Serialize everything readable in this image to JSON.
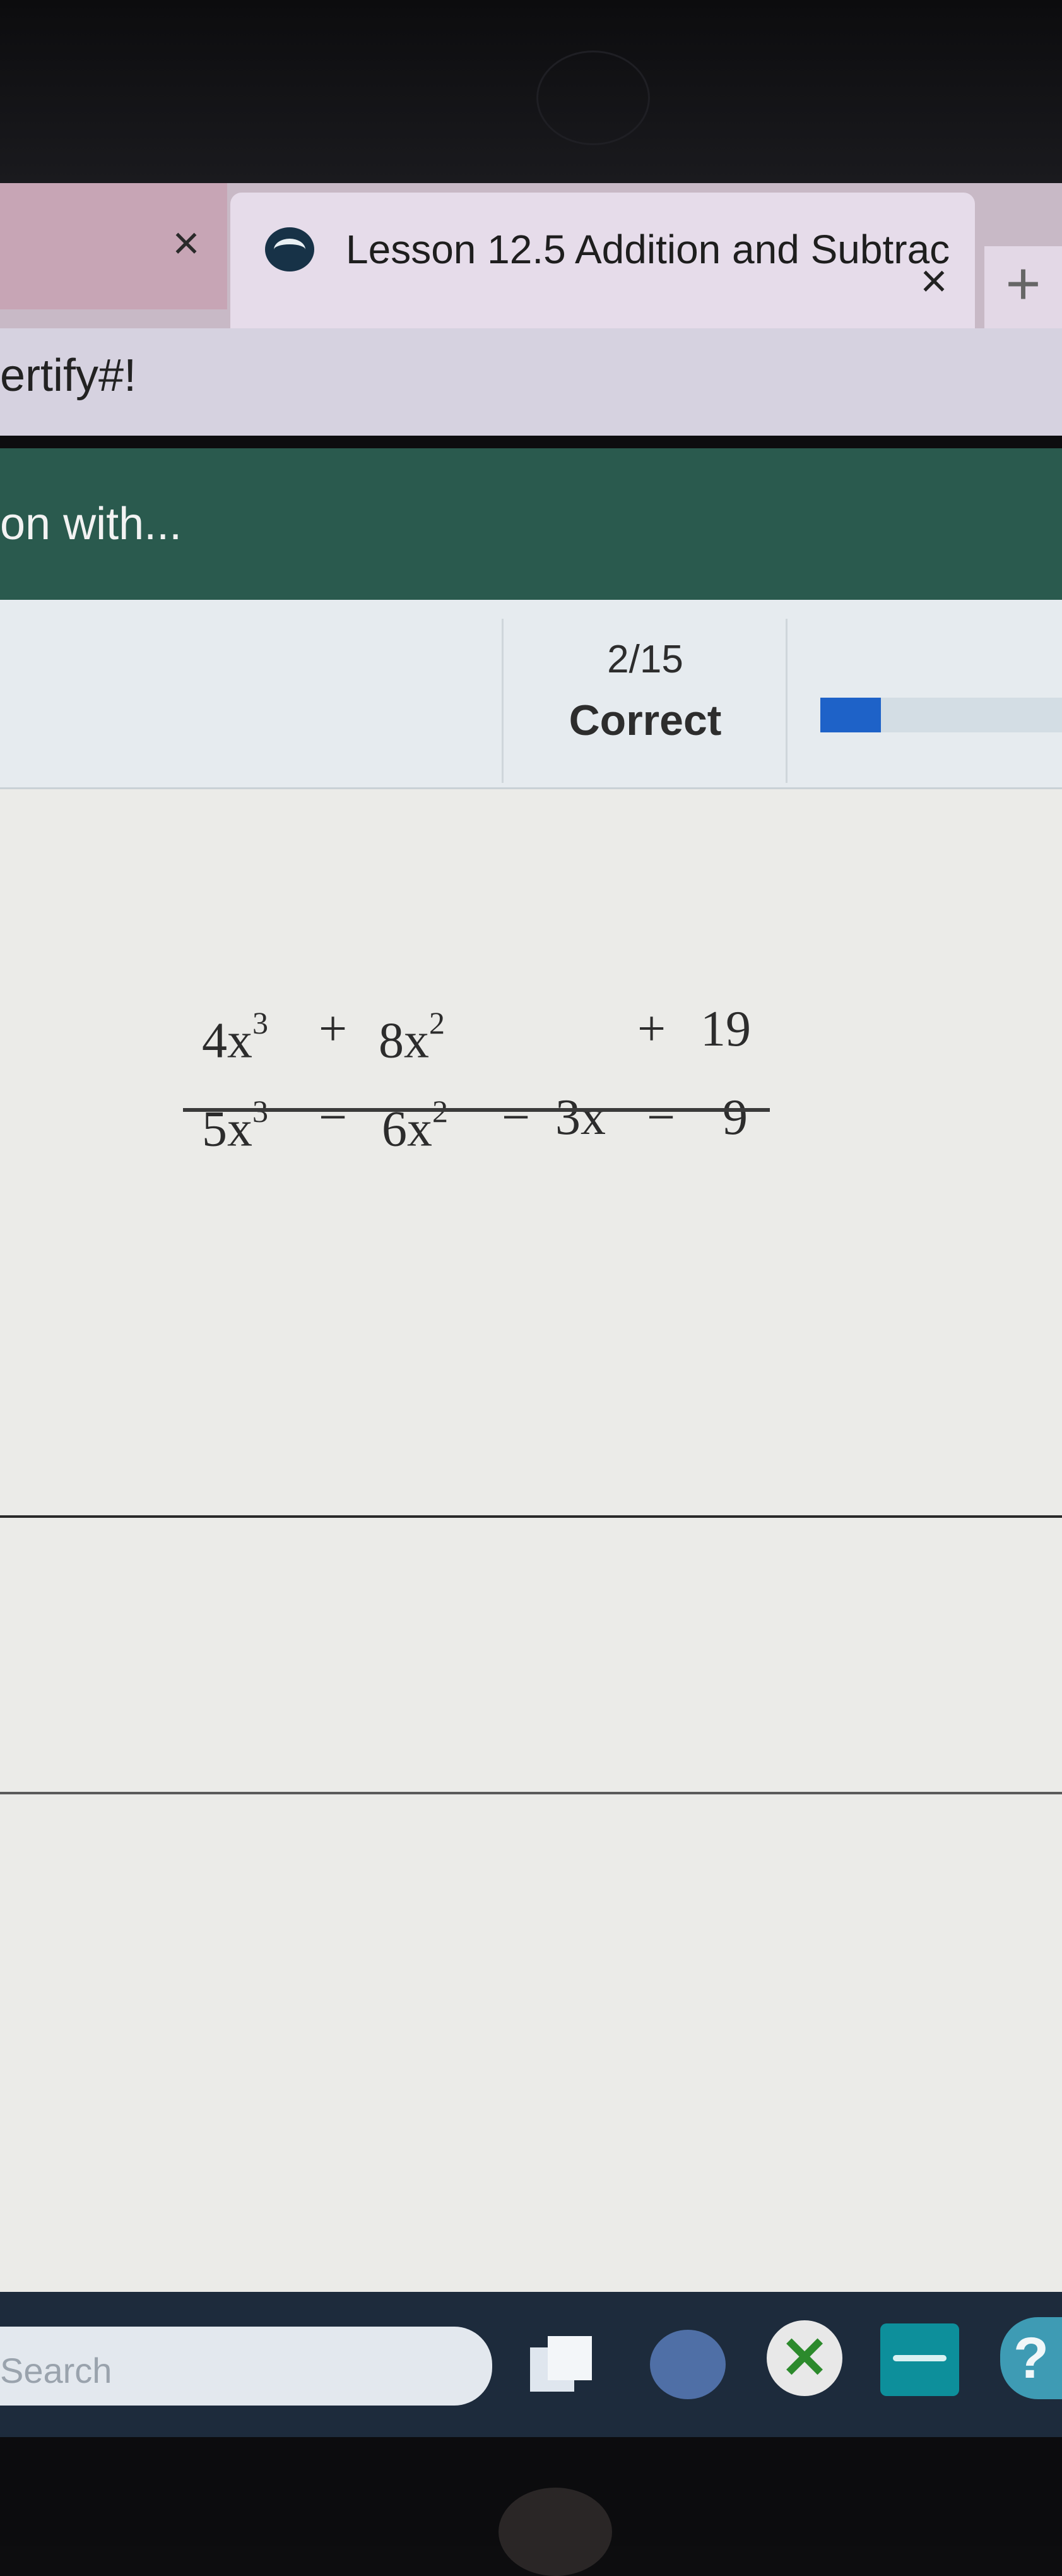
{
  "browser": {
    "inactive_tab_close": "×",
    "active_tab": {
      "title": "Lesson 12.5 Addition and Subtrac",
      "close": "×"
    },
    "new_tab": "+",
    "address_text": "ertify#!"
  },
  "header": {
    "text": "on with..."
  },
  "score": {
    "count": "2/15",
    "label": "Correct",
    "progress": 0.25,
    "progress_color": "#1e62c8"
  },
  "problem": {
    "row1": {
      "a": "4x",
      "a_exp": "3",
      "op1": "+",
      "b": "8x",
      "b_exp": "2",
      "op3": "+",
      "d": "19"
    },
    "row2": {
      "a": "5x",
      "a_exp": "3",
      "op1": "−",
      "b": "6x",
      "b_exp": "2",
      "op2": "−",
      "c": "3x",
      "op3": "−",
      "d": "9"
    }
  },
  "taskbar": {
    "search_text": "Search",
    "icons": [
      "task-view-icon",
      "chat-icon",
      "xbox-icon",
      "app-icon",
      "help-icon"
    ]
  }
}
